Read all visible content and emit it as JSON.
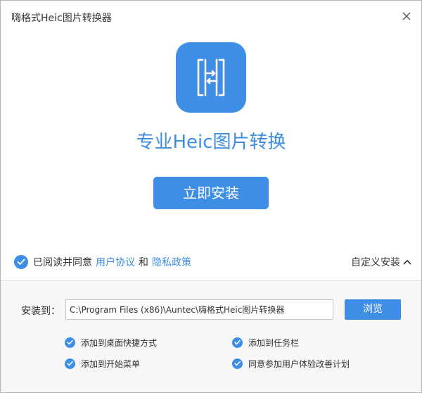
{
  "window": {
    "title": "嗨格式Heic图片转换器"
  },
  "hero": {
    "headline": "专业Heic图片转换",
    "install_button": "立即安装"
  },
  "agreement": {
    "prefix": "已阅读并同意",
    "user_agreement_link": "用户协议",
    "conjunction": "和",
    "privacy_policy_link": "隐私政策",
    "checked": true
  },
  "custom_install": {
    "label": "自定义安装",
    "expanded": true
  },
  "install_path": {
    "label": "安装到：",
    "value": "C:\\Program Files (x86)\\Auntec\\嗨格式Heic图片转换器",
    "browse_button": "浏览"
  },
  "options": [
    {
      "label": "添加到桌面快捷方式",
      "checked": true
    },
    {
      "label": "添加到任务栏",
      "checked": true
    },
    {
      "label": "添加到开始菜单",
      "checked": true
    },
    {
      "label": "同意参加用户体验改善计划",
      "checked": true
    }
  ],
  "colors": {
    "accent": "#3f8ee6",
    "link": "#3d8de0",
    "panel_background": "#f7f7f7"
  }
}
